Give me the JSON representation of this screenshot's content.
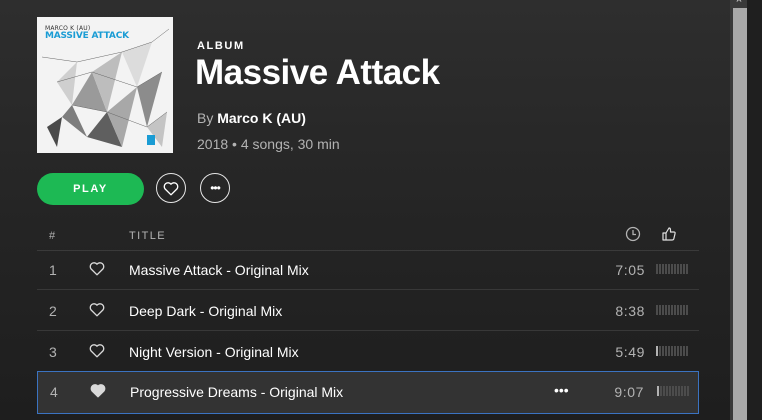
{
  "album": {
    "cover": {
      "artist_text": "MARCO K (AU)",
      "title_text": "MASSIVE ATTACK"
    },
    "type_label": "ALBUM",
    "title": "Massive Attack",
    "by_prefix": "By",
    "artist": "Marco K (AU)",
    "meta": "2018 • 4 songs, 30 min"
  },
  "actions": {
    "play_label": "PLAY",
    "more_label": "•••"
  },
  "table": {
    "headers": {
      "number": "#",
      "title": "TITLE"
    },
    "tracks": [
      {
        "number": "1",
        "title": "Massive Attack - Original Mix",
        "duration": "7:05",
        "popularity": 0.0,
        "selected": false
      },
      {
        "number": "2",
        "title": "Deep Dark - Original Mix",
        "duration": "8:38",
        "popularity": 0.0,
        "selected": false
      },
      {
        "number": "3",
        "title": "Night Version - Original Mix",
        "duration": "5:49",
        "popularity": 0.1,
        "selected": false
      },
      {
        "number": "4",
        "title": "Progressive Dreams - Original Mix",
        "duration": "9:07",
        "popularity": 0.1,
        "selected": true,
        "more_label": "•••"
      }
    ]
  },
  "colors": {
    "accent": "#1db954",
    "selection_border": "#3b73c1",
    "cover_text": "#1a9cd4"
  },
  "icons": {
    "clock": "clock-icon",
    "like": "thumbs-up-icon",
    "heart": "heart-icon"
  }
}
